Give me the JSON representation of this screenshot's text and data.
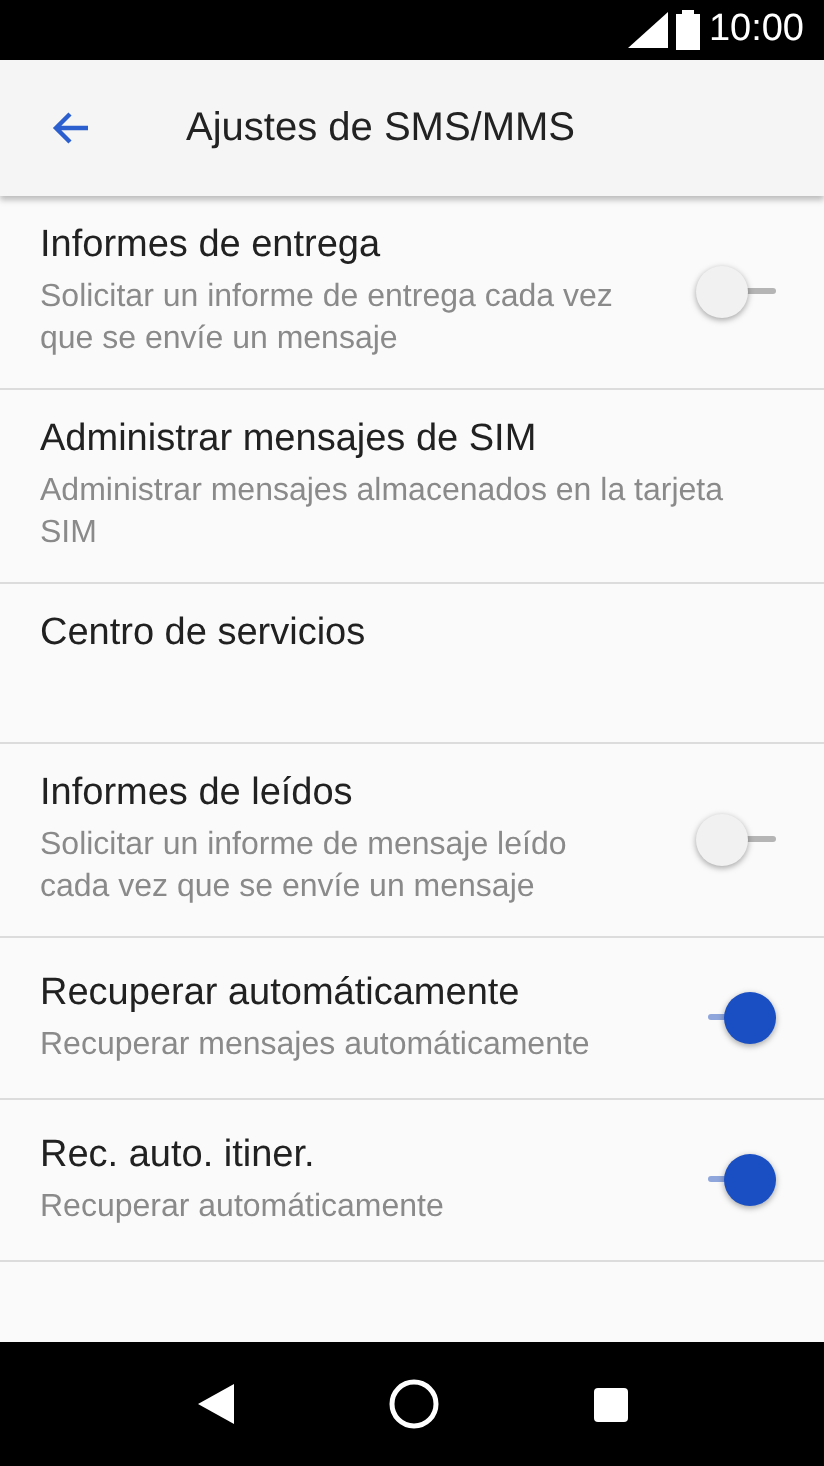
{
  "status_bar": {
    "time": "10:00"
  },
  "toolbar": {
    "title": "Ajustes de SMS/MMS"
  },
  "settings": [
    {
      "kind": "switch",
      "title": "Informes de entrega",
      "subtitle": "Solicitar un informe de entrega cada vez que se envíe un mensaje",
      "on": false
    },
    {
      "kind": "plain",
      "title": "Administrar mensajes de SIM",
      "subtitle": "Administrar mensajes almacenados en la tarjeta SIM"
    },
    {
      "kind": "plain",
      "title": "Centro de servicios"
    },
    {
      "kind": "switch",
      "title": "Informes de leídos",
      "subtitle": "Solicitar un informe de mensaje leído cada vez que se envíe un mensaje",
      "on": false
    },
    {
      "kind": "switch",
      "title": "Recuperar automáticamente",
      "subtitle": "Recuperar mensajes automáticamente",
      "on": true
    },
    {
      "kind": "switch",
      "title": "Rec. auto. itiner.",
      "subtitle": "Recuperar automáticamente",
      "on": true
    }
  ]
}
